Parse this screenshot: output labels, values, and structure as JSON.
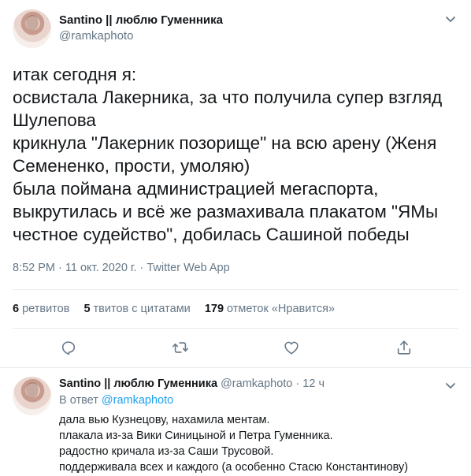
{
  "tweet": {
    "display_name": "Santino || люблю Гуменника",
    "handle": "@ramkaphoto",
    "lines": [
      "итак сегодня я:",
      "освистала Лакерника, за что получила супер взгляд",
      "Шулепова",
      "крикнула \"Лакерник позорище\" на всю арену (Женя",
      "Семененко, прости, умоляю)",
      "была поймана администрацией мегаспорта,",
      "выкрутилась и всё же размахивала плакатом \"ЯМы",
      "честное судейство\", добилась Сашиной победы"
    ],
    "meta": "8:52 PM · 11 окт. 2020 г. · Twitter Web App",
    "stats": {
      "retweets_count": "6",
      "retweets_label": "ретвитов",
      "quotes_count": "5",
      "quotes_label": "твитов с цитатами",
      "likes_count": "179",
      "likes_label": "отметок «Нравится»"
    },
    "icons": [
      "reply-icon",
      "retweet-icon",
      "like-icon",
      "share-icon"
    ]
  },
  "reply": {
    "display_name": "Santino || люблю Гуменника",
    "handle": "@ramkaphoto",
    "dot": "·",
    "time": "12 ч",
    "in_reply_prefix": "В ответ",
    "in_reply_handle": "@ramkaphoto",
    "lines": [
      "дала вью Кузнецову, нахамила ментам.",
      "плакала из-за Вики Синицыной и Петра Гуменника.",
      "радостно кричала из-за Саши Трусовой.",
      "поддерживала всех и каждого (а особенно Стасю Константинову)"
    ]
  },
  "colors": {
    "text": "#14171a",
    "secondary": "#657786",
    "accent": "#1da1f2",
    "border": "#e6ecf0"
  }
}
